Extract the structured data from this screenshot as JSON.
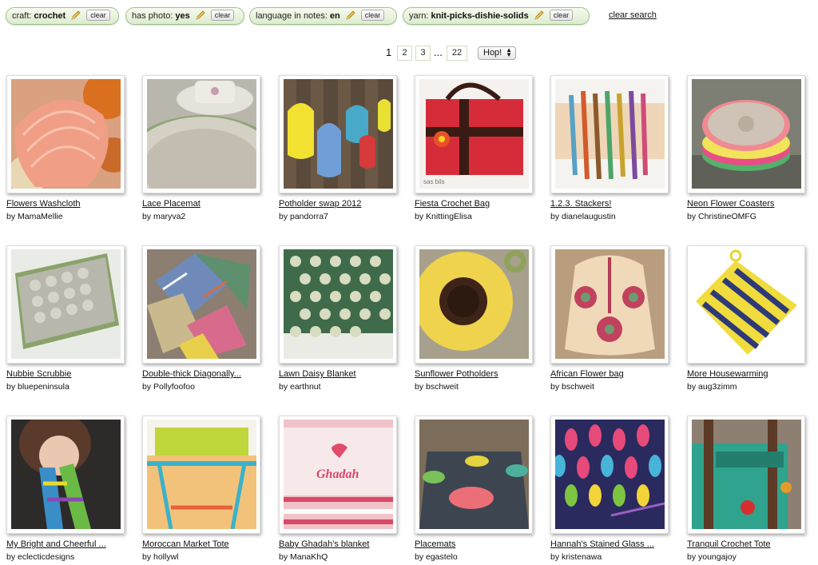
{
  "filters": [
    {
      "key": "craft:",
      "value": "crochet",
      "clear": "clear"
    },
    {
      "key": "has photo:",
      "value": "yes",
      "clear": "clear"
    },
    {
      "key": "language in notes:",
      "value": "en",
      "clear": "clear"
    },
    {
      "key": "yarn:",
      "value": "knit-picks-dishie-solids",
      "clear": "clear"
    }
  ],
  "clear_search": "clear search",
  "pagination": {
    "current": "1",
    "pages": [
      "2",
      "3"
    ],
    "ellipsis": "...",
    "last": "22",
    "hop": "Hop!"
  },
  "patterns": [
    {
      "title": "Flowers Washcloth",
      "author": "by MamaMellie"
    },
    {
      "title": "Lace Placemat",
      "author": "by maryva2"
    },
    {
      "title": "Potholder swap 2012",
      "author": "by pandorra7"
    },
    {
      "title": "Fiesta Crochet Bag",
      "author": "by KnittingElisa"
    },
    {
      "title": "1.2.3. Stackers!",
      "author": "by dianelaugustin"
    },
    {
      "title": "Neon Flower Coasters",
      "author": "by ChristineOMFG"
    },
    {
      "title": "Nubbie Scrubbie",
      "author": "by bluepeninsula"
    },
    {
      "title": "Double-thick Diagonally...",
      "author": "by Pollyfoofoo"
    },
    {
      "title": "Lawn Daisy Blanket",
      "author": "by earthnut"
    },
    {
      "title": "Sunflower Potholders",
      "author": "by bschweit"
    },
    {
      "title": "African Flower bag",
      "author": "by bschweit"
    },
    {
      "title": "More Housewarming",
      "author": "by aug3zimm"
    },
    {
      "title": "My Bright and Cheerful ...",
      "author": "by eclecticdesigns"
    },
    {
      "title": "Moroccan Market Tote",
      "author": "by hollywl"
    },
    {
      "title": "Baby Ghadah's blanket",
      "author": "by ManaKhQ"
    },
    {
      "title": "Placemats",
      "author": "by egastelo"
    },
    {
      "title": "Hannah's Stained Glass ...",
      "author": "by kristenawa"
    },
    {
      "title": "Tranquil Crochet Tote",
      "author": "by youngajoy"
    }
  ],
  "photo_text": {
    "sasbils": "sas bils",
    "ghadah": "Ghadah"
  }
}
